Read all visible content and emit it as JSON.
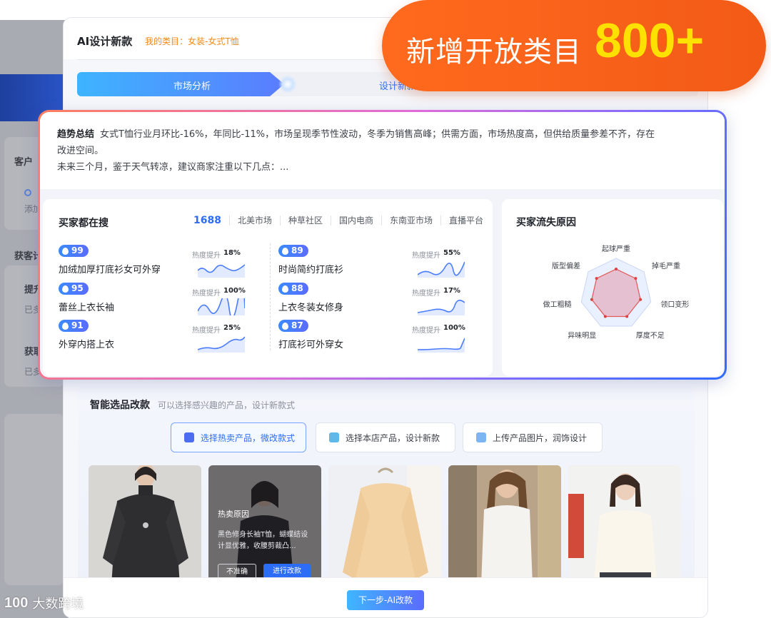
{
  "background": {
    "labels": [
      "客户",
      "添加",
      "获客计",
      "提升",
      "已多",
      "获取",
      "已多"
    ]
  },
  "panel": {
    "title": "AI设计新款",
    "category": "我的类目：女装-女式T恤",
    "steps": [
      "市场分析",
      "设计新款"
    ]
  },
  "trend": {
    "lead": "趋势总结",
    "line1": "女式T恤行业月环比-16%，年同比-11%，市场呈现季节性波动，冬季为销售高峰；供需方面，市场热度高，但供给质量参差不齐，存在",
    "line2": "改进空间。",
    "line3": "未来三个月，鉴于天气转凉，建议商家注重以下几点：..."
  },
  "search": {
    "title": "买家都在搜",
    "tabs": [
      "1688",
      "北美市场",
      "种草社区",
      "国内电商",
      "东南亚市场",
      "直播平台"
    ],
    "heat_label": "热度提升",
    "keywords": [
      {
        "badge": "99",
        "text": "加绒加厚打底衫女可外穿",
        "heat": "18%"
      },
      {
        "badge": "95",
        "text": "蕾丝上衣长袖",
        "heat": "100%"
      },
      {
        "badge": "91",
        "text": "外穿内搭上衣",
        "heat": "25%"
      },
      {
        "badge": "89",
        "text": "时尚简约打底衫",
        "heat": "55%"
      },
      {
        "badge": "88",
        "text": "上衣冬装女修身",
        "heat": "17%"
      },
      {
        "badge": "87",
        "text": "打底衫可外穿女",
        "heat": "100%"
      }
    ]
  },
  "churn": {
    "title": "买家流失原因",
    "axes": [
      "起球严重",
      "掉毛严重",
      "领口变形",
      "厚度不足",
      "异味明显",
      "做工粗糙",
      "版型偏差"
    ]
  },
  "selection": {
    "title": "智能选品改款",
    "subtitle": "可以选择感兴趣的产品，设计新款式",
    "options": [
      "选择热卖产品，微改款式",
      "选择本店产品，设计新款",
      "上传产品图片，润饰设计"
    ],
    "overlay": {
      "title": "热卖原因",
      "desc": "黑色修身长袖T恤，蝴蝶结设计显优雅，收腰剪裁凸...",
      "btn_ghost": "不准确",
      "btn_primary": "进行改款"
    }
  },
  "footer": {
    "next": "下一步-AI改款"
  },
  "promo": {
    "text": "新增开放类目",
    "number": "800+"
  },
  "watermark": {
    "logo": "100",
    "text": "大数跨境"
  },
  "colors": {
    "accent": "#2d6cf6",
    "orange": "#f25a16",
    "yellow": "#ffe100",
    "category": "#f08a1c"
  }
}
